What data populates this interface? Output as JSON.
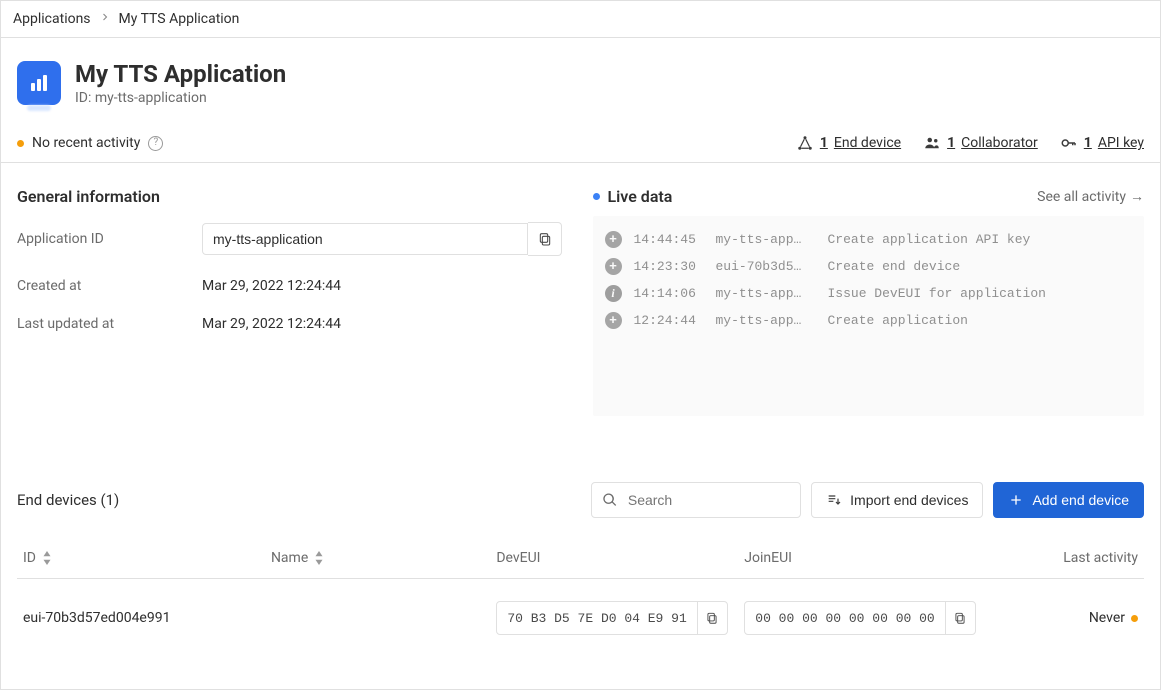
{
  "breadcrumb": {
    "root": "Applications",
    "current": "My TTS Application"
  },
  "header": {
    "title": "My TTS Application",
    "id_prefix": "ID:",
    "id_value": "my-tts-application"
  },
  "statusbar": {
    "activity": "No recent activity",
    "end_devices": {
      "count": "1",
      "label": "End device"
    },
    "collaborators": {
      "count": "1",
      "label": "Collaborator"
    },
    "api_keys": {
      "count": "1",
      "label": "API key"
    }
  },
  "general_info": {
    "title": "General information",
    "app_id_label": "Application ID",
    "app_id_value": "my-tts-application",
    "created_label": "Created at",
    "created_value": "Mar 29, 2022 12:24:44",
    "updated_label": "Last updated at",
    "updated_value": "Mar 29, 2022 12:24:44"
  },
  "live_data": {
    "title": "Live data",
    "see_all": "See all activity",
    "events": [
      {
        "icon": "plus",
        "time": "14:44:45",
        "entity": "my-tts-app…",
        "message": "Create application API key"
      },
      {
        "icon": "plus",
        "time": "14:23:30",
        "entity": "eui-70b3d5…",
        "message": "Create end device"
      },
      {
        "icon": "info",
        "time": "14:14:06",
        "entity": "my-tts-app…",
        "message": "Issue DevEUI for application"
      },
      {
        "icon": "plus",
        "time": "12:24:44",
        "entity": "my-tts-app…",
        "message": "Create application"
      }
    ]
  },
  "devices": {
    "title": "End devices (1)",
    "search_placeholder": "Search",
    "import_label": "Import end devices",
    "add_label": "Add end device",
    "columns": {
      "id": "ID",
      "name": "Name",
      "deveui": "DevEUI",
      "joineui": "JoinEUI",
      "last_activity": "Last activity"
    },
    "rows": [
      {
        "id": "eui-70b3d57ed004e991",
        "name": "",
        "deveui": "70 B3 D5 7E D0 04 E9 91",
        "joineui": "00 00 00 00 00 00 00 00",
        "last_activity": "Never"
      }
    ]
  }
}
